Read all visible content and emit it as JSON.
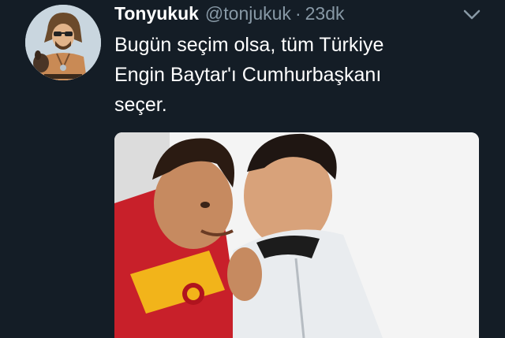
{
  "tweet": {
    "display_name": "Tonyukuk",
    "handle": "@tonjukuk",
    "separator": "·",
    "time": "23dk",
    "text_lines": [
      "Bugün seçim olsa, tüm Türkiye",
      "Engin Baytar'ı Cumhurbaşkanı",
      "seçer."
    ],
    "icons": {
      "avatar": "cartoon-avatar",
      "menu": "chevron-down-icon"
    }
  },
  "colors": {
    "background": "#141d26",
    "name": "#ffffff",
    "secondary": "#8899a6",
    "text": "#ffffff"
  }
}
